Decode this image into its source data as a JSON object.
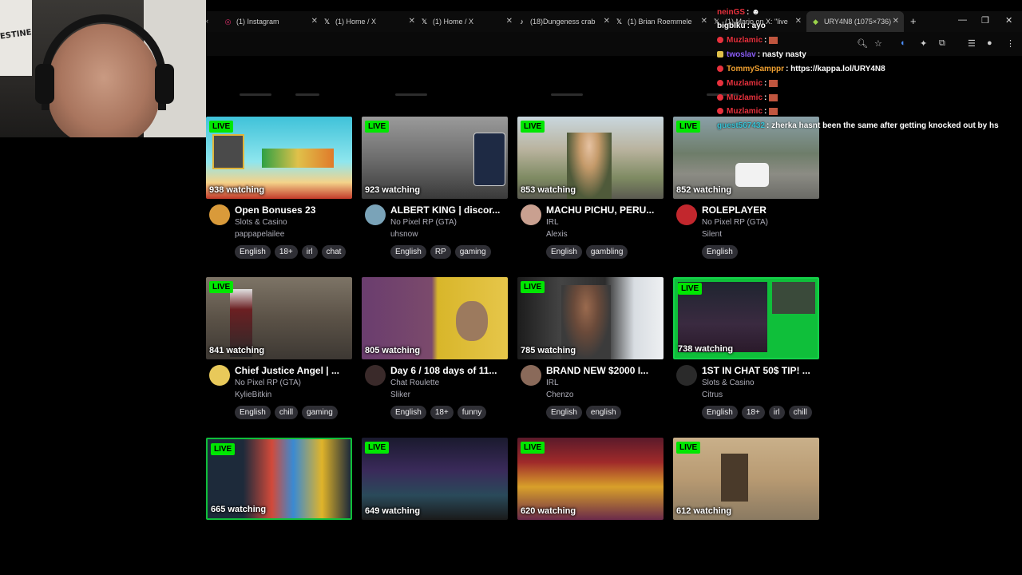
{
  "tabs": [
    {
      "icon": "instagram-icon",
      "label": "(1) Instagram"
    },
    {
      "icon": "x-logo-icon",
      "label": "(1) Home / X"
    },
    {
      "icon": "x-logo-icon",
      "label": "(1) Home / X"
    },
    {
      "icon": "tiktok-icon",
      "label": "(18)Dungeness crab"
    },
    {
      "icon": "x-logo-icon",
      "label": "(1) Brian Roemmele"
    },
    {
      "icon": "x-logo-icon",
      "label": "(1) Mario on X: \"live"
    },
    {
      "icon": "page-icon",
      "label": "URY4N8 (1075×736)"
    }
  ],
  "webcam_poster_text": "ESTINE",
  "chat": [
    {
      "user": "neinGS",
      "message": "",
      "user_color": "#e8313d"
    },
    {
      "user": "bigblku",
      "message": "ayo",
      "user_color": "#ffffff"
    },
    {
      "user": "Muzlamic",
      "message": "",
      "user_color": "#e8313d"
    },
    {
      "user": "twoslav",
      "message": "nasty nasty",
      "user_color": "#8a5cf5"
    },
    {
      "user": "TommySamppr",
      "message": "https://kappa.lol/URY4N8",
      "user_color": "#f0a030"
    },
    {
      "user": "Muzlamic",
      "message": "",
      "user_color": "#e8313d"
    },
    {
      "user": "Muzlamic",
      "message": "",
      "user_color": "#e8313d"
    },
    {
      "user": "Muzlamic",
      "message": "",
      "user_color": "#e8313d"
    },
    {
      "user": "guest567432",
      "message": "zherka hasnt been the same after getting knocked out by hs",
      "user_color": "#37c3d6"
    }
  ],
  "live_label": "LIVE",
  "streams": [
    {
      "watching": "938 watching",
      "title": "Open Bonuses 23",
      "category": "Slots & Casino",
      "streamer": "pappapelailee",
      "tags": [
        "English",
        "18+",
        "irl",
        "chat"
      ]
    },
    {
      "watching": "923 watching",
      "title": "ALBERT KING | discor...",
      "category": "No Pixel RP (GTA)",
      "streamer": "uhsnow",
      "tags": [
        "English",
        "RP",
        "gaming"
      ]
    },
    {
      "watching": "853 watching",
      "title": "MACHU PICHU, PERU...",
      "category": "IRL",
      "streamer": "Alexis",
      "tags": [
        "English",
        "gambling"
      ]
    },
    {
      "watching": "852 watching",
      "title": "ROLEPLAYER",
      "category": "No Pixel RP (GTA)",
      "streamer": "Silent",
      "tags": [
        "English"
      ]
    },
    {
      "watching": "841 watching",
      "title": "Chief Justice Angel | ...",
      "category": "No Pixel RP (GTA)",
      "streamer": "KylieBitkin",
      "tags": [
        "English",
        "chill",
        "gaming"
      ]
    },
    {
      "watching": "805 watching",
      "title": "Day 6 / 108 days of 11...",
      "category": "Chat Roulette",
      "streamer": "Sliker",
      "tags": [
        "English",
        "18+",
        "funny"
      ]
    },
    {
      "watching": "785 watching",
      "title": "BRAND NEW $2000 I...",
      "category": "IRL",
      "streamer": "Chenzo",
      "tags": [
        "English",
        "english"
      ]
    },
    {
      "watching": "738 watching",
      "title": "1ST IN CHAT 50$ TIP! ...",
      "category": "Slots & Casino",
      "streamer": "Citrus",
      "tags": [
        "English",
        "18+",
        "irl",
        "chill"
      ]
    },
    {
      "watching": "665 watching"
    },
    {
      "watching": "649 watching"
    },
    {
      "watching": "620 watching"
    },
    {
      "watching": "612 watching"
    }
  ],
  "colors": {
    "live_badge": "#00e701",
    "tag_bg": "#2f2f35",
    "meta_text": "#adadb8"
  }
}
